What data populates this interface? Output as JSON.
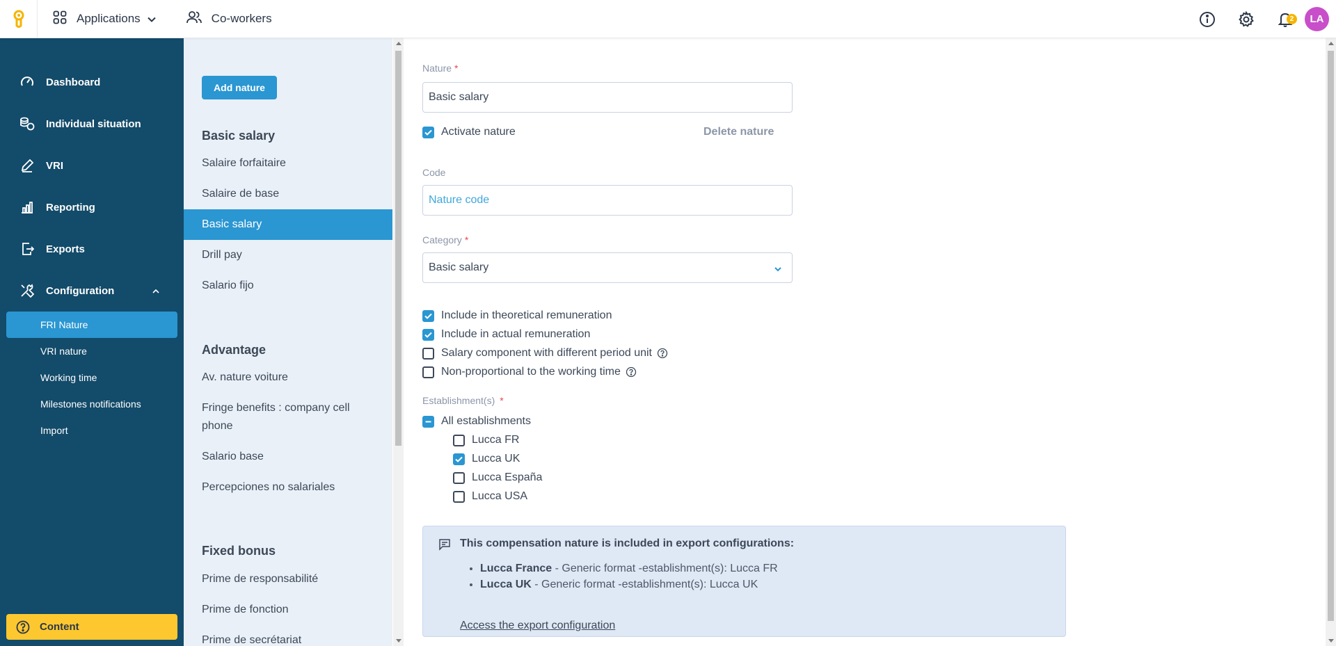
{
  "topbar": {
    "applications_label": "Applications",
    "coworkers_label": "Co-workers",
    "notification_count": "2",
    "avatar_initials": "LA"
  },
  "sidebar": {
    "items": [
      {
        "label": "Dashboard",
        "icon": "speedometer-icon"
      },
      {
        "label": "Individual situation",
        "icon": "people-coins-icon"
      },
      {
        "label": "VRI",
        "icon": "pen-icon"
      },
      {
        "label": "Reporting",
        "icon": "bar-chart-icon"
      },
      {
        "label": "Exports",
        "icon": "export-icon"
      },
      {
        "label": "Configuration",
        "icon": "tools-icon"
      }
    ],
    "sub_items": [
      "FRI Nature",
      "VRI nature",
      "Working time",
      "Milestones notifications",
      "Import"
    ],
    "content_label": "Content"
  },
  "list": {
    "add_label": "Add nature",
    "groups": [
      {
        "title": "Basic salary",
        "items": [
          "Salaire forfaitaire",
          "Salaire de base",
          "Basic salary",
          "Drill pay",
          "Salario fijo"
        ]
      },
      {
        "title": "Advantage",
        "items": [
          "Av. nature voiture",
          "Fringe benefits : company cell phone",
          "Salario base",
          "Percepciones no salariales"
        ]
      },
      {
        "title": "Fixed bonus",
        "items": [
          "Prime de responsabilité",
          "Prime de fonction",
          "Prime de secrétariat"
        ]
      }
    ]
  },
  "form": {
    "nature_label": "Nature",
    "nature_value": "Basic salary",
    "activate_label": "Activate nature",
    "delete_label": "Delete nature",
    "code_label": "Code",
    "code_placeholder": "Nature code",
    "category_label": "Category",
    "category_value": "Basic salary",
    "options": [
      {
        "label": "Include in theoretical remuneration",
        "checked": true
      },
      {
        "label": "Include in actual remuneration",
        "checked": true
      },
      {
        "label": "Salary component with different period unit",
        "checked": false
      },
      {
        "label": "Non-proportional to the working time",
        "checked": false
      }
    ],
    "establishments_label": "Establishment(s)",
    "all_establishments_label": "All establishments",
    "establishments": [
      {
        "label": "Lucca FR",
        "checked": false
      },
      {
        "label": "Lucca UK",
        "checked": true
      },
      {
        "label": "Lucca España",
        "checked": false
      },
      {
        "label": "Lucca USA",
        "checked": false
      }
    ]
  },
  "info": {
    "title": "This compensation nature is included in export configurations:",
    "exports": [
      {
        "name": "Lucca France",
        "detail": " - Generic format -establishment(s): Lucca FR"
      },
      {
        "name": "Lucca UK",
        "detail": " - Generic format -establishment(s): Lucca UK"
      }
    ],
    "link_label": "Access the export configuration"
  },
  "colors": {
    "sidebar_bg": "#134b6a",
    "accent": "#2a96d2",
    "content_button": "#fdc82f",
    "avatar": "#c84fc9",
    "badge": "#f6b400"
  }
}
